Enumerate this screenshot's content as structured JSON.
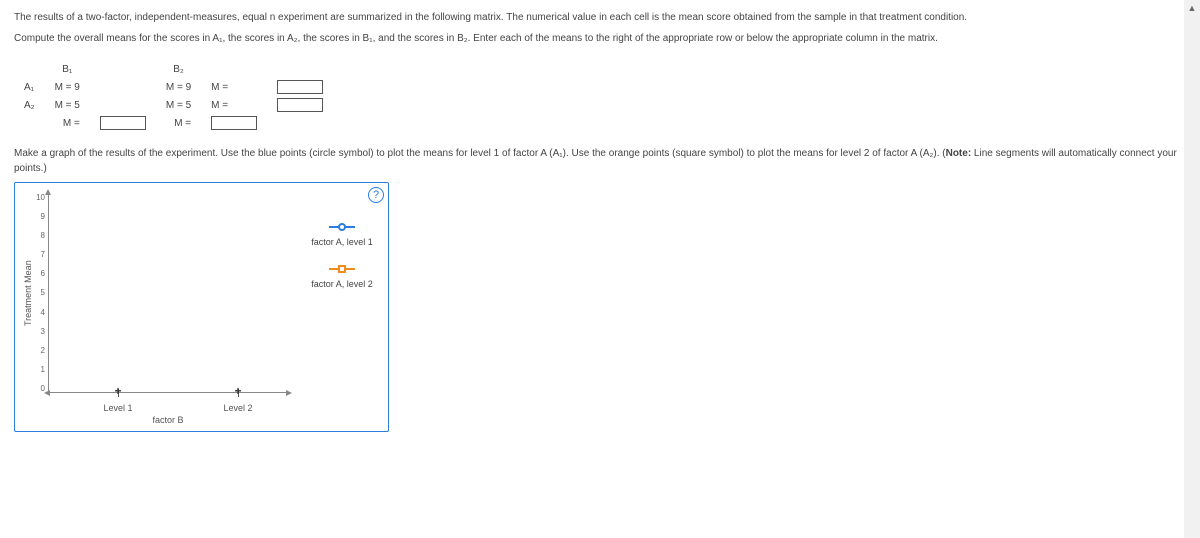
{
  "para1": "The results of a two-factor, independent-measures, equal n experiment are summarized in the following matrix. The numerical value in each cell is the mean score obtained from the sample in that treatment condition.",
  "para2": "Compute the overall means for the scores in A₁, the scores in A₂, the scores in B₁, and the scores in B₂. Enter each of the means to the right of the appropriate row or below the appropriate column in the matrix.",
  "matrix": {
    "col1": "B₁",
    "col2": "B₂",
    "rowA1": "A₁",
    "rowA2": "A₂",
    "a1b1": "M = 9",
    "a1b2": "M = 9",
    "a2b1": "M = 5",
    "a2b2": "M = 5",
    "meq": "M ="
  },
  "para3a": "Make a graph of the results of the experiment. Use the blue points (circle symbol) to plot the means for level 1 of factor A (A₁). Use the orange points (square symbol) to plot the means for level 2 of factor A (A₂). (",
  "para3note": "Note:",
  "para3b": " Line segments will automatically connect your points.)",
  "graph": {
    "help": "?",
    "ylabel": "Treatment Mean",
    "xlabel": "factor B",
    "xt1": "Level 1",
    "xt2": "Level 2",
    "yticks": [
      "10",
      "9",
      "8",
      "7",
      "6",
      "5",
      "4",
      "3",
      "2",
      "1",
      "0"
    ],
    "legend1": "factor A, level 1",
    "legend2": "factor A, level 2"
  },
  "chart_data": {
    "type": "line",
    "title": "",
    "xlabel": "factor B",
    "ylabel": "Treatment Mean",
    "ylim": [
      0,
      10
    ],
    "categories": [
      "Level 1",
      "Level 2"
    ],
    "series": [
      {
        "name": "factor A, level 1",
        "symbol": "circle",
        "color": "#2a7de1",
        "values": []
      },
      {
        "name": "factor A, level 2",
        "symbol": "square",
        "color": "#f08b1d",
        "values": []
      }
    ],
    "note": "Interactive plotting area; no points placed yet."
  },
  "scroll": {
    "up": "▲",
    "down": "▼"
  }
}
